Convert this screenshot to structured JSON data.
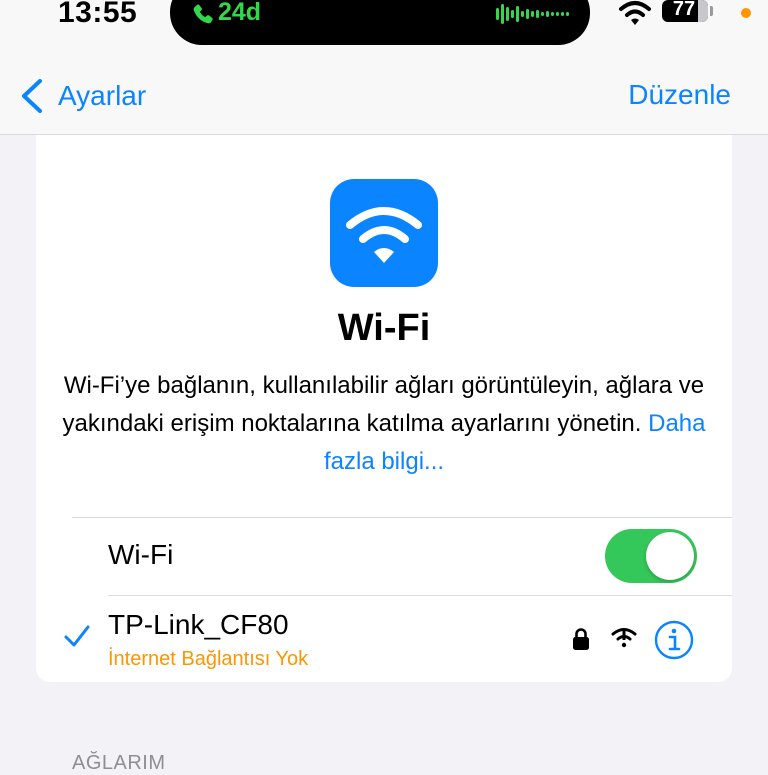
{
  "status_bar": {
    "time": "13:55",
    "call_duration": "24d",
    "battery": "77",
    "icons": [
      "phone-icon",
      "audio-waveform-icon",
      "wifi-status-icon",
      "battery-icon",
      "privacy-indicator-dot"
    ]
  },
  "nav": {
    "back_label": "Ayarlar",
    "edit_label": "Düzenle"
  },
  "header": {
    "title": "Wi-Fi",
    "description": "Wi-Fi’ye bağlanın, kullanılabilir ağları görüntüleyin, ağlara ve yakındaki erişim noktalarına katılma ayarlarını yönetin.",
    "link": "Daha fazla bilgi..."
  },
  "wifi_toggle": {
    "label": "Wi-Fi",
    "on": true
  },
  "current_network": {
    "name": "TP-Link_CF80",
    "status": "İnternet Bağlantısı Yok",
    "secured": true
  },
  "my_networks_header": "AĞLARIM",
  "colors": {
    "accent": "#0a84ff",
    "toggle_on": "#34c759",
    "warning": "#ff9500",
    "call_green": "#32d74b"
  }
}
